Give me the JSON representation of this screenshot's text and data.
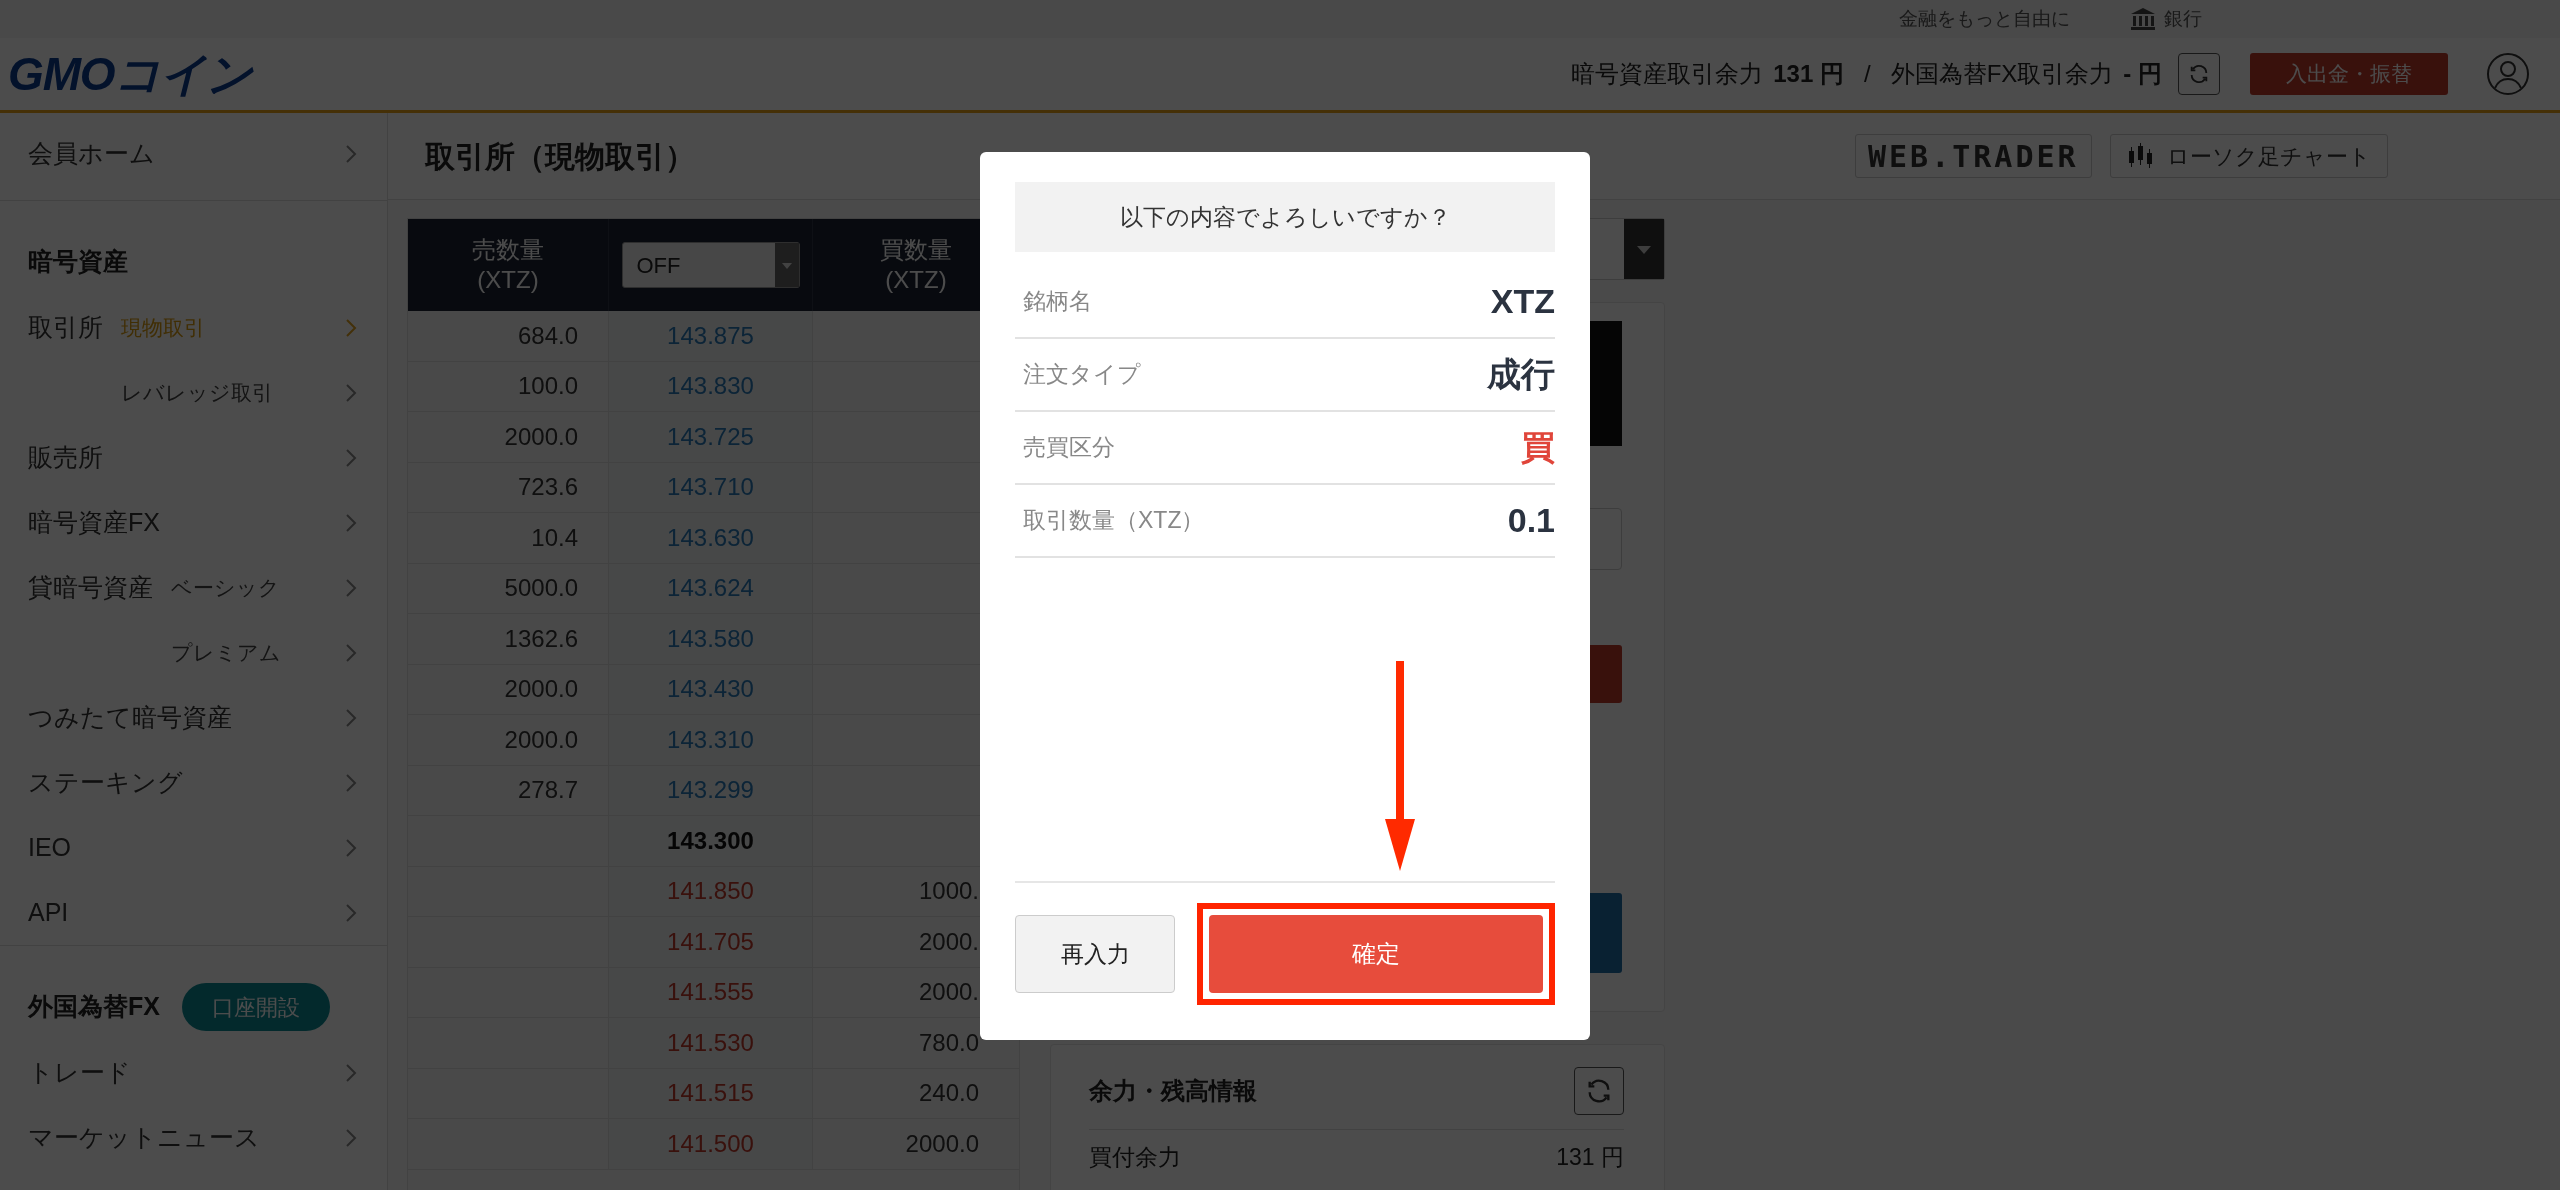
{
  "top_links": [
    {
      "label": "金融をもっと自由に"
    },
    {
      "label": "銀行"
    }
  ],
  "header": {
    "logo": "GMOコイン",
    "crypto_label": "暗号資産取引余力",
    "crypto_value": "131 円",
    "separator": "/",
    "fx_label": "外国為替FX取引余力",
    "fx_value": "- 円",
    "deposit_button": "入出金・振替"
  },
  "sidebar": [
    {
      "items": [
        {
          "label": "会員ホーム"
        }
      ]
    },
    {
      "heading": "暗号資産",
      "items": [
        {
          "label": "取引所",
          "options": [
            {
              "label": "現物取引",
              "selected": true
            },
            {
              "label": "レバレッジ取引",
              "selected": false
            }
          ]
        },
        {
          "label": "販売所"
        },
        {
          "label": "暗号資産FX"
        },
        {
          "label": "貸暗号資産",
          "options": [
            {
              "label": "ベーシック",
              "selected": false
            },
            {
              "label": "プレミアム",
              "selected": false
            }
          ]
        },
        {
          "label": "つみたて暗号資産"
        },
        {
          "label": "ステーキング"
        },
        {
          "label": "IEO"
        },
        {
          "label": "API"
        }
      ]
    },
    {
      "heading": "外国為替FX",
      "heading_button": "口座開設",
      "items": [
        {
          "label": "トレード"
        },
        {
          "label": "マーケットニュース"
        }
      ]
    }
  ],
  "page_title": "取引所（現物取引）",
  "toolbar": {
    "web_trader": "WEB.TRADER",
    "chart_button": "ローソク足チャート"
  },
  "order_book": {
    "sell_header": {
      "title": "売数量",
      "unit": "(XTZ)"
    },
    "select": "OFF",
    "buy_header": {
      "title": "買数量",
      "unit": "(XTZ)"
    },
    "rows": [
      {
        "kind": "ask",
        "qty": "684.0",
        "price": "143.875"
      },
      {
        "kind": "ask",
        "qty": "100.0",
        "price": "143.830"
      },
      {
        "kind": "ask",
        "qty": "2000.0",
        "price": "143.725"
      },
      {
        "kind": "ask",
        "qty": "723.6",
        "price": "143.710"
      },
      {
        "kind": "ask",
        "qty": "10.4",
        "price": "143.630"
      },
      {
        "kind": "ask",
        "qty": "5000.0",
        "price": "143.624"
      },
      {
        "kind": "ask",
        "qty": "1362.6",
        "price": "143.580"
      },
      {
        "kind": "ask",
        "qty": "2000.0",
        "price": "143.430"
      },
      {
        "kind": "ask",
        "qty": "2000.0",
        "price": "143.310"
      },
      {
        "kind": "ask",
        "qty": "278.7",
        "price": "143.299"
      },
      {
        "kind": "mid",
        "price": "143.300"
      },
      {
        "kind": "bid",
        "qty": "1000.",
        "price": "141.850"
      },
      {
        "kind": "bid",
        "qty": "2000.",
        "price": "141.705"
      },
      {
        "kind": "bid",
        "qty": "2000.",
        "price": "141.555"
      },
      {
        "kind": "bid",
        "qty": "780.0",
        "price": "141.530"
      },
      {
        "kind": "bid",
        "qty": "240.0",
        "price": "141.515"
      },
      {
        "kind": "bid",
        "qty": "2000.0",
        "price": "141.500"
      }
    ]
  },
  "balance_card": {
    "title": "余力・残高情報",
    "rows": [
      {
        "label": "買付余力",
        "value": "131 円"
      }
    ]
  },
  "dialog": {
    "question": "以下の内容でよろしいですか？",
    "rows": [
      {
        "label": "銘柄名",
        "value": "XTZ",
        "kind": "plain"
      },
      {
        "label": "注文タイプ",
        "value": "成行",
        "kind": "plain"
      },
      {
        "label": "売買区分",
        "value": "買",
        "kind": "buy"
      },
      {
        "label": "取引数量（XTZ）",
        "value": "0.1",
        "kind": "plain"
      }
    ],
    "cancel_button": "再入力",
    "confirm_button": "確定",
    "confirm_highlighted": true
  }
}
